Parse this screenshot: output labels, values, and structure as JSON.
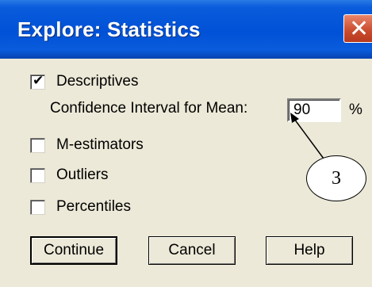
{
  "window": {
    "title": "Explore: Statistics",
    "close_symbol": "✕"
  },
  "options": {
    "descriptives": {
      "label": "Descriptives",
      "checked": true
    },
    "confidence_interval": {
      "label": "Confidence Interval for Mean:",
      "value": "90",
      "unit": "%"
    },
    "m_estimators": {
      "label": "M-estimators",
      "checked": false
    },
    "outliers": {
      "label": "Outliers",
      "checked": false
    },
    "percentiles": {
      "label": "Percentiles",
      "checked": false
    }
  },
  "buttons": {
    "continue": "Continue",
    "cancel": "Cancel",
    "help": "Help"
  },
  "annotation": {
    "label": "3"
  }
}
